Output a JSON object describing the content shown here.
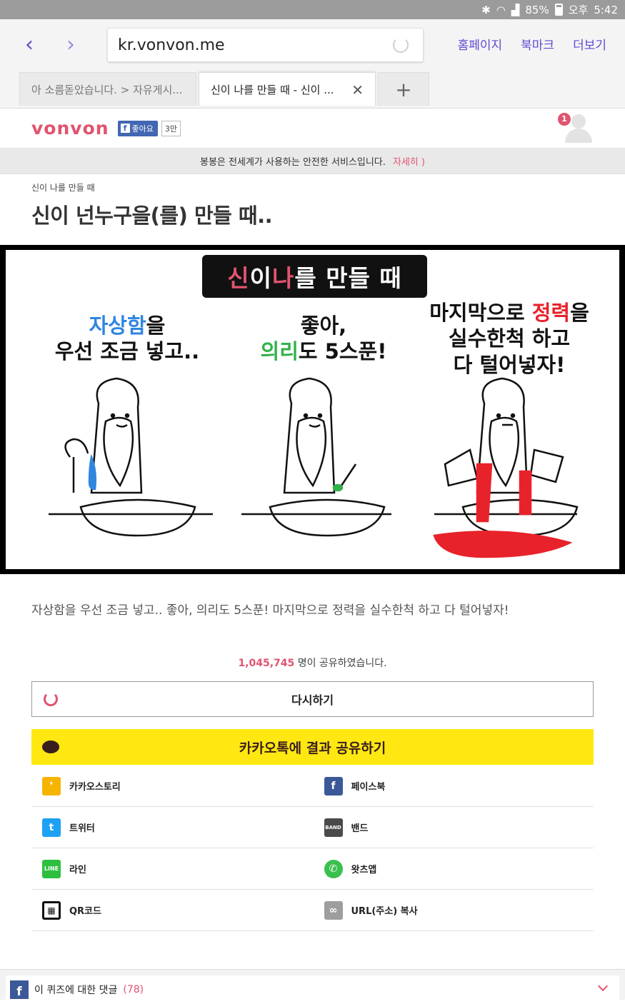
{
  "status_bar": {
    "battery": "85%",
    "ampm": "오후",
    "time": "5:42"
  },
  "browser": {
    "back_icon": "chevron-left-icon",
    "forward_icon": "chevron-right-icon",
    "url": "kr.vonvon.me",
    "links": [
      "홈페이지",
      "북마크",
      "더보기"
    ],
    "tabs": [
      {
        "title": "아 소름돋았습니다. > 자유게시...",
        "active": false
      },
      {
        "title": "신이 나를 만들 때 - 신이 ...",
        "active": true
      }
    ],
    "new_tab": "+"
  },
  "site": {
    "logo": "vonvon",
    "fb_like": "좋아요",
    "fb_like_count": "3만",
    "notification_count": "1",
    "notice": "봉봉은 전세계가 사용하는 안전한 서비스입니다.",
    "notice_more": "자세히 )"
  },
  "quiz": {
    "breadcrumb": "신이 나를 만들 때",
    "title": "신이 넌누구을(를) 만들 때..",
    "image": {
      "banner_part1": "신",
      "banner_part2": "이 ",
      "banner_part3": "나",
      "banner_part4": "를 만들 때",
      "panel1_highlight": "자상함",
      "panel1_line1_rest": "을",
      "panel1_line2": "우선 조금 넣고..",
      "panel2_line1": "좋아,",
      "panel2_highlight": "의리",
      "panel2_line2_rest": "도 5스푼!",
      "panel3_line1_pre": "마지막으로 ",
      "panel3_highlight": "정력",
      "panel3_line1_rest": "을",
      "panel3_line2": "실수한척 하고",
      "panel3_line3": "다 털어넣자!"
    },
    "caption": "자상함을 우선 조금 넣고.. 좋아, 의리도 5스푼! 마지막으로 정력을 실수한척 하고 다 털어넣자!",
    "share_count": "1,045,745",
    "share_suffix": " 명이 공유하였습니다.",
    "retry_label": "다시하기",
    "kakao_share": "카카오톡에 결과 공유하기"
  },
  "share_options": [
    {
      "label": "카카오스토리",
      "icon": "kakaostory-icon",
      "color": "#f6b400"
    },
    {
      "label": "페이스북",
      "icon": "facebook-icon",
      "color": "#3b5998"
    },
    {
      "label": "트위터",
      "icon": "twitter-icon",
      "color": "#1da1f2"
    },
    {
      "label": "밴드",
      "icon": "band-icon",
      "color": "#4a4a4a"
    },
    {
      "label": "라인",
      "icon": "line-icon",
      "color": "#2fbf3f"
    },
    {
      "label": "왓츠앱",
      "icon": "whatsapp-icon",
      "color": "#3bbf4e"
    },
    {
      "label": "QR코드",
      "icon": "qr-code-icon",
      "color": "#111111"
    },
    {
      "label": "URL(주소) 복사",
      "icon": "link-icon",
      "color": "#9e9e9e"
    }
  ],
  "comments": {
    "label": "이 퀴즈에 대한 댓글",
    "count": "(78)"
  },
  "colors": {
    "brand": "#e0546f",
    "browser_accent": "#5e4bd0",
    "kakao": "#ffe812"
  }
}
